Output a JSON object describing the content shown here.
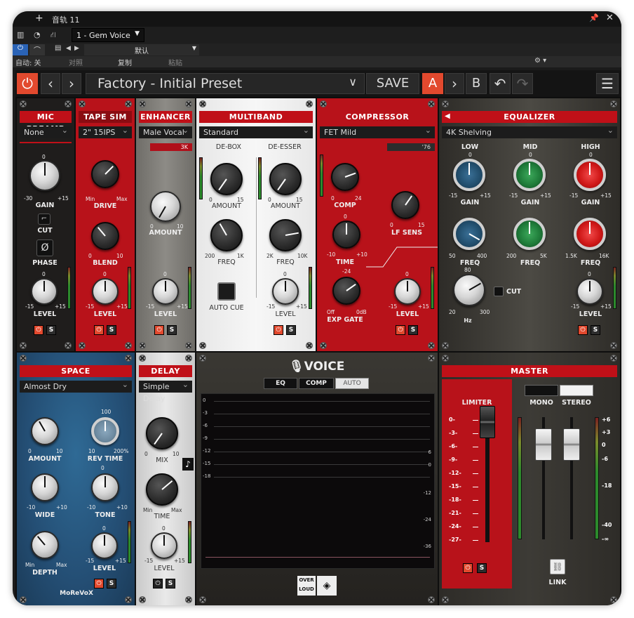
{
  "host": {
    "track_title": "音轨 11",
    "plugin_slot": "1 - Gem Voice",
    "preset_name": "默认",
    "auto_label": "自动: 关",
    "compare_label": "对照",
    "copy_label": "复制",
    "paste_label": "粘贴"
  },
  "toolbar": {
    "preset_name": "Factory - Initial Preset",
    "save_label": "SAVE",
    "slot_a": "A",
    "slot_b": "B"
  },
  "modules": {
    "mic_preamp": {
      "title": "MIC PREAMP",
      "preset": "None",
      "gain_label": "GAIN",
      "gain_top": "0",
      "gain_min": "-30",
      "gain_max": "+15",
      "cut_label": "CUT",
      "phase_label": "PHASE",
      "level_label": "LEVEL",
      "level_top": "0",
      "level_min": "-15",
      "level_max": "+15"
    },
    "tape_sim": {
      "title": "TAPE SIM",
      "preset": "2\" 15IPS",
      "drive_label": "DRIVE",
      "drive_min": "Min",
      "drive_max": "Max",
      "blend_label": "BLEND",
      "blend_min": "0",
      "blend_max": "10",
      "level_label": "LEVEL",
      "level_top": "0",
      "level_min": "-15",
      "level_max": "+15"
    },
    "enhancer": {
      "title": "ENHANCER",
      "preset": "Male Vocal",
      "freq_tag": "3K",
      "amount_label": "AMOUNT",
      "amount_min": "0",
      "amount_max": "10",
      "level_label": "LEVEL",
      "level_top": "0",
      "level_min": "-15",
      "level_max": "+15"
    },
    "multiband": {
      "title": "MULTIBAND",
      "preset": "Standard",
      "debox_label": "DE-BOX",
      "desser_label": "DE-ESSER",
      "amount_label": "AMOUNT",
      "amount_min": "0",
      "amount_max": "15",
      "freq_label": "FREQ",
      "debox_freq_min": "200",
      "debox_freq_max": "1K",
      "desser_freq_min": "2K",
      "desser_freq_max": "10K",
      "auto_cue_label": "AUTO CUE",
      "level_label": "LEVEL",
      "level_top": "0",
      "level_min": "-15",
      "level_max": "+15"
    },
    "compressor": {
      "title": "COMPRESSOR",
      "preset": "FET Mild",
      "model_tag": "'76",
      "comp_label": "COMP",
      "comp_min": "0",
      "comp_max": "24",
      "lfsens_label": "LF SENS",
      "lfsens_min": "0",
      "lfsens_max": "15",
      "time_label": "TIME",
      "time_top": "0",
      "time_min": "-10",
      "time_max": "+10",
      "gate_label": "EXP GATE",
      "gate_top": "-24",
      "gate_min": "Off",
      "gate_max": "0dB",
      "level_label": "LEVEL",
      "level_top": "0",
      "level_min": "-15",
      "level_max": "+15"
    },
    "equalizer": {
      "title": "EQUALIZER",
      "preset": "4K Shelving",
      "low_label": "LOW",
      "mid_label": "MID",
      "high_label": "HIGH",
      "gain_label": "GAIN",
      "gain_top": "0",
      "gain_min": "-15",
      "gain_max": "+15",
      "freq_label": "FREQ",
      "low_freq_min": "50",
      "low_freq_max": "400",
      "mid_freq_min": "200",
      "mid_freq_max": "5K",
      "high_freq_min": "1.5K",
      "high_freq_max": "16K",
      "hz_top": "80",
      "hz_min": "20",
      "hz_max": "300",
      "hz_label": "Hz",
      "cut_label": "CUT",
      "level_label": "LEVEL",
      "level_top": "0",
      "level_min": "-15",
      "level_max": "+15"
    },
    "space": {
      "title": "SPACE",
      "preset": "Almost Dry",
      "amount_label": "AMOUNT",
      "amount_min": "0",
      "amount_max": "10",
      "revtime_label": "REV TIME",
      "revtime_top": "100",
      "revtime_min": "10",
      "revtime_max": "200%",
      "wide_label": "WIDE",
      "wide_min": "-10",
      "wide_max": "+10",
      "tone_label": "TONE",
      "tone_top": "0",
      "tone_min": "-10",
      "tone_max": "+10",
      "depth_label": "DEPTH",
      "depth_min": "Min",
      "depth_max": "Max",
      "level_label": "LEVEL",
      "level_top": "0",
      "level_min": "-15",
      "level_max": "+15",
      "brand": "MoReVoX"
    },
    "delay": {
      "title": "DELAY",
      "preset": "Simple Delay",
      "mix_label": "MIX",
      "mix_min": "0",
      "mix_max": "10",
      "time_label": "TIME",
      "time_min": "Min",
      "time_max": "Max",
      "level_label": "LEVEL",
      "level_top": "0",
      "level_min": "-15",
      "level_max": "+15"
    },
    "voice": {
      "title": "VOICE",
      "tabs": [
        "EQ",
        "COMP",
        "AUTO"
      ],
      "left_scale": [
        "0",
        "-3",
        "-6",
        "-9",
        "-12",
        "-15",
        "-18"
      ],
      "right_scale_a": [
        "6",
        "0"
      ],
      "right_scale_b": [
        "-12",
        "-24",
        "-36"
      ],
      "logo_top": "OVER",
      "logo_bottom": "LOUD"
    },
    "master": {
      "title": "MASTER",
      "limiter_label": "LIMITER",
      "mono_label": "MONO",
      "stereo_label": "STEREO",
      "limiter_scale": [
        "0",
        "-3",
        "-6",
        "-9",
        "-12",
        "-15",
        "-18",
        "-21",
        "-24",
        "-27"
      ],
      "fader_scale": [
        "+6",
        "+3",
        "0",
        "-6",
        "-18",
        "-40",
        "-∞"
      ],
      "link_label": "LINK"
    }
  },
  "common": {
    "power_glyph": "⏻",
    "solo_label": "S"
  },
  "colors": {
    "accent_red": "#c01018",
    "power_orange": "#e2492e",
    "space_blue": "#244e74"
  }
}
